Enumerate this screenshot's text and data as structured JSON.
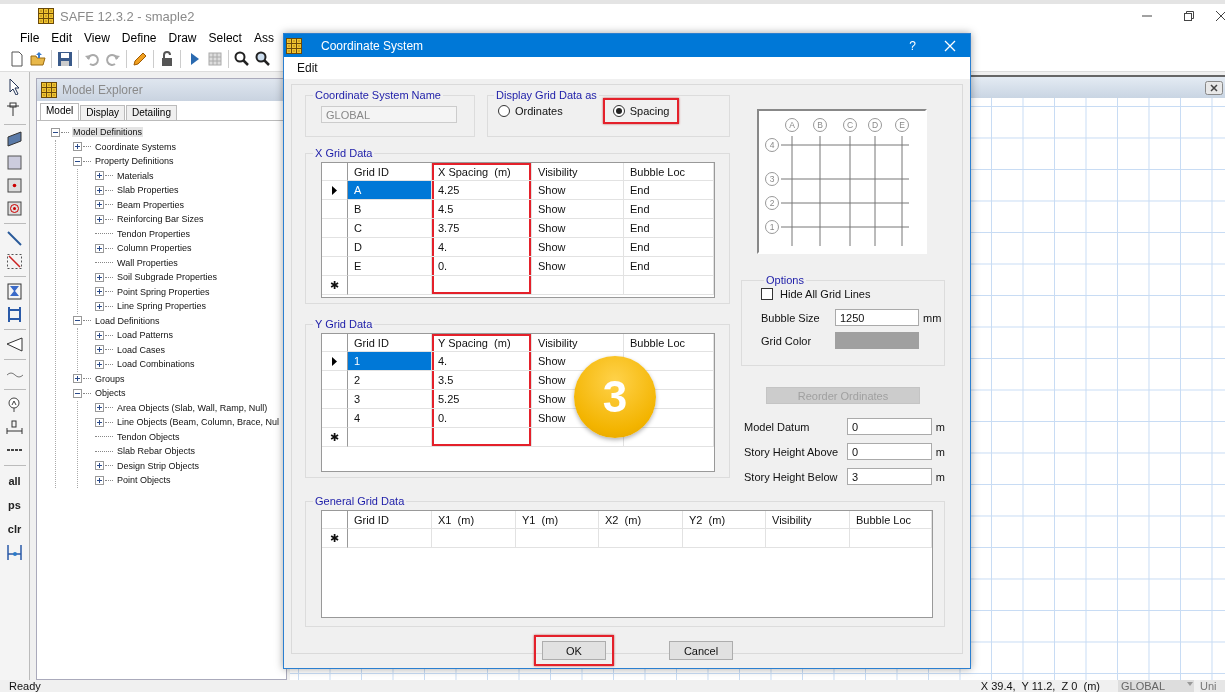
{
  "window": {
    "title": "SAFE 12.3.2 - smaple2"
  },
  "menu": [
    "File",
    "Edit",
    "View",
    "Define",
    "Draw",
    "Select",
    "Ass"
  ],
  "side_toolbar": {
    "text_buttons": [
      "all",
      "ps",
      "clr"
    ]
  },
  "model_explorer": {
    "title": "Model Explorer",
    "tabs": [
      {
        "label": "Model",
        "selected": true
      },
      {
        "label": "Display",
        "selected": false
      },
      {
        "label": "Detailing",
        "selected": false
      }
    ],
    "tree": [
      {
        "label": "Model Definitions",
        "kind": "expandable",
        "expanded": true,
        "selected": true,
        "children": [
          {
            "label": "Coordinate Systems",
            "kind": "expandable",
            "expanded": false,
            "selected": false
          },
          {
            "label": "Property Definitions",
            "kind": "expandable",
            "expanded": true,
            "selected": false,
            "children": [
              {
                "label": "Materials",
                "kind": "expandable",
                "expanded": false,
                "selected": false
              },
              {
                "label": "Slab Properties",
                "kind": "expandable",
                "expanded": false,
                "selected": false
              },
              {
                "label": "Beam Properties",
                "kind": "expandable",
                "expanded": false,
                "selected": false
              },
              {
                "label": "Reinforcing Bar Sizes",
                "kind": "expandable",
                "expanded": false,
                "selected": false
              },
              {
                "label": "Tendon Properties",
                "kind": "leaf",
                "selected": false
              },
              {
                "label": "Column Properties",
                "kind": "expandable",
                "expanded": false,
                "selected": false
              },
              {
                "label": "Wall Properties",
                "kind": "leaf",
                "selected": false
              },
              {
                "label": "Soil Subgrade Properties",
                "kind": "expandable",
                "expanded": false,
                "selected": false
              },
              {
                "label": "Point Spring Properties",
                "kind": "expandable",
                "expanded": false,
                "selected": false
              },
              {
                "label": "Line Spring Properties",
                "kind": "expandable",
                "expanded": false,
                "selected": false
              }
            ]
          },
          {
            "label": "Load Definitions",
            "kind": "expandable",
            "expanded": true,
            "selected": false,
            "children": [
              {
                "label": "Load Patterns",
                "kind": "expandable",
                "expanded": false,
                "selected": false
              },
              {
                "label": "Load Cases",
                "kind": "expandable",
                "expanded": false,
                "selected": false
              },
              {
                "label": "Load Combinations",
                "kind": "expandable",
                "expanded": false,
                "selected": false
              }
            ]
          },
          {
            "label": "Groups",
            "kind": "expandable",
            "expanded": false,
            "selected": false
          },
          {
            "label": "Objects",
            "kind": "expandable",
            "expanded": true,
            "selected": false,
            "children": [
              {
                "label": "Area Objects (Slab, Wall, Ramp, Null)",
                "kind": "expandable",
                "expanded": false,
                "selected": false
              },
              {
                "label": "Line Objects (Beam, Column, Brace, Nul",
                "kind": "expandable",
                "expanded": false,
                "selected": false
              },
              {
                "label": "Tendon Objects",
                "kind": "leaf",
                "selected": false
              },
              {
                "label": "Slab Rebar Objects",
                "kind": "leaf",
                "selected": false
              },
              {
                "label": "Design Strip Objects",
                "kind": "expandable",
                "expanded": false,
                "selected": false
              },
              {
                "label": "Point Objects",
                "kind": "expandable",
                "expanded": false,
                "selected": false
              }
            ]
          }
        ]
      }
    ]
  },
  "dialog": {
    "title": "Coordinate System",
    "help_button": "?",
    "menu": [
      "Edit"
    ],
    "name_group": {
      "label": "Coordinate System Name",
      "value": "GLOBAL",
      "disabled": true
    },
    "display_group": {
      "label": "Display Grid Data as",
      "options": [
        {
          "label": "Ordinates",
          "selected": false,
          "highlighted": false
        },
        {
          "label": "Spacing",
          "selected": true,
          "highlighted": true
        }
      ]
    },
    "x_grid": {
      "label": "X Grid Data",
      "new_row_marker": "✱",
      "columns": [
        {
          "label": "Grid ID",
          "highlighted": false
        },
        {
          "label": "X Spacing  (m)",
          "highlighted": true
        },
        {
          "label": "Visibility",
          "highlighted": false
        },
        {
          "label": "Bubble Loc",
          "highlighted": false
        }
      ],
      "rows": [
        {
          "selected": true,
          "cells": [
            "A",
            "4.25",
            "Show",
            "End"
          ]
        },
        {
          "selected": false,
          "cells": [
            "B",
            "4.5",
            "Show",
            "End"
          ]
        },
        {
          "selected": false,
          "cells": [
            "C",
            "3.75",
            "Show",
            "End"
          ]
        },
        {
          "selected": false,
          "cells": [
            "D",
            "4.",
            "Show",
            "End"
          ]
        },
        {
          "selected": false,
          "cells": [
            "E",
            "0.",
            "Show",
            "End"
          ]
        }
      ]
    },
    "y_grid": {
      "label": "Y Grid Data",
      "new_row_marker": "✱",
      "columns": [
        {
          "label": "Grid ID",
          "highlighted": false
        },
        {
          "label": "Y Spacing  (m)",
          "highlighted": true
        },
        {
          "label": "Visibility",
          "highlighted": false
        },
        {
          "label": "Bubble Loc",
          "highlighted": false
        }
      ],
      "rows": [
        {
          "selected": true,
          "cells": [
            "1",
            "4.",
            "Show"
          ]
        },
        {
          "selected": false,
          "cells": [
            "2",
            "3.5",
            "Show"
          ]
        },
        {
          "selected": false,
          "cells": [
            "3",
            "5.25",
            "Show"
          ]
        },
        {
          "selected": false,
          "cells": [
            "4",
            "0.",
            "Show"
          ]
        }
      ]
    },
    "preview": {
      "x_bubbles": [
        "A",
        "B",
        "C",
        "D",
        "E"
      ],
      "y_bubbles": [
        "4",
        "3",
        "2",
        "1"
      ]
    },
    "options": {
      "label": "Options",
      "hide_grid_lines": {
        "label": "Hide All Grid Lines",
        "checked": false
      },
      "bubble_size": {
        "label": "Bubble Size",
        "value": "1250",
        "unit": "mm"
      },
      "grid_color": {
        "label": "Grid Color",
        "color": "#a0a0a0"
      }
    },
    "reorder_button": {
      "label": "Reorder Ordinates",
      "disabled": true
    },
    "story_fields": [
      {
        "label": "Model Datum",
        "value": "0",
        "unit": "m"
      },
      {
        "label": "Story Height Above",
        "value": "0",
        "unit": "m"
      },
      {
        "label": "Story Height Below",
        "value": "3",
        "unit": "m"
      }
    ],
    "general_grid": {
      "label": "General Grid Data",
      "new_row_marker": "✱",
      "columns": [
        "Grid ID",
        "X1  (m)",
        "Y1  (m)",
        "X2  (m)",
        "Y2  (m)",
        "Visibility",
        "Bubble Loc"
      ]
    },
    "buttons": [
      {
        "label": "OK",
        "highlighted": true
      },
      {
        "label": "Cancel",
        "highlighted": false
      }
    ]
  },
  "step_badge": {
    "label": "3"
  },
  "status_bar": {
    "status": "Ready",
    "coordinates": "X 39.4,  Y 11.2,  Z 0  (m)",
    "coord_system": "GLOBAL",
    "units": "Uni"
  }
}
